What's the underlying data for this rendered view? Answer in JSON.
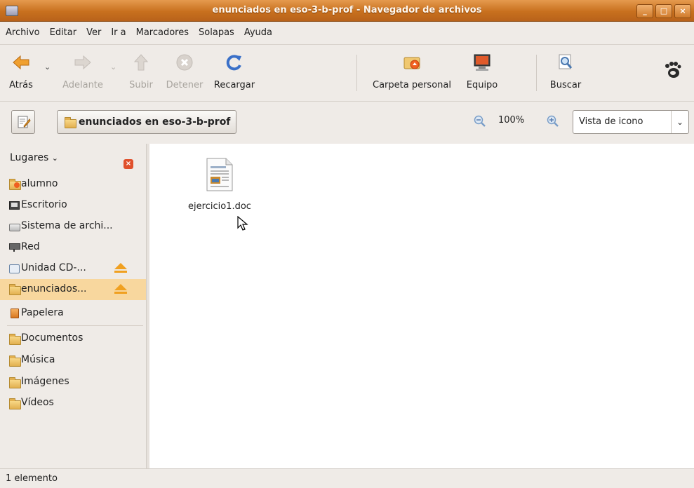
{
  "window": {
    "title": "enunciados en eso-3-b-prof - Navegador de archivos",
    "controls": [
      "_",
      "□",
      "×"
    ]
  },
  "menubar": [
    "Archivo",
    "Editar",
    "Ver",
    "Ir a",
    "Marcadores",
    "Solapas",
    "Ayuda"
  ],
  "toolbar": {
    "back": "Atrás",
    "forward": "Adelante",
    "up": "Subir",
    "stop": "Detener",
    "reload": "Recargar",
    "home": "Carpeta personal",
    "computer": "Equipo",
    "search": "Buscar"
  },
  "location": {
    "path": "enunciados en eso-3-b-prof",
    "zoom": "100%",
    "view": "Vista de icono"
  },
  "sidebar": {
    "header": "Lugares",
    "items": [
      {
        "label": "alumno",
        "icon": "home-folder-icon"
      },
      {
        "label": "Escritorio",
        "icon": "desktop-icon"
      },
      {
        "label": "Sistema de archi...",
        "icon": "drive-icon"
      },
      {
        "label": "Red",
        "icon": "network-icon"
      },
      {
        "label": "Unidad CD-...",
        "icon": "cd-icon"
      },
      {
        "label": "enunciados...",
        "icon": "network-folder-icon"
      },
      {
        "label": "Papelera",
        "icon": "trash-icon"
      },
      {
        "label": "Documentos",
        "icon": "folder-icon"
      },
      {
        "label": "Música",
        "icon": "folder-icon"
      },
      {
        "label": "Imágenes",
        "icon": "folder-icon"
      },
      {
        "label": "Vídeos",
        "icon": "folder-icon"
      }
    ]
  },
  "files": [
    {
      "name": "ejercicio1.doc",
      "icon": "document-icon"
    }
  ],
  "status": "1 elemento",
  "colors": {
    "titlebar": "#c8701e",
    "selected": "#f8d79e",
    "eject": "#f0a020"
  }
}
